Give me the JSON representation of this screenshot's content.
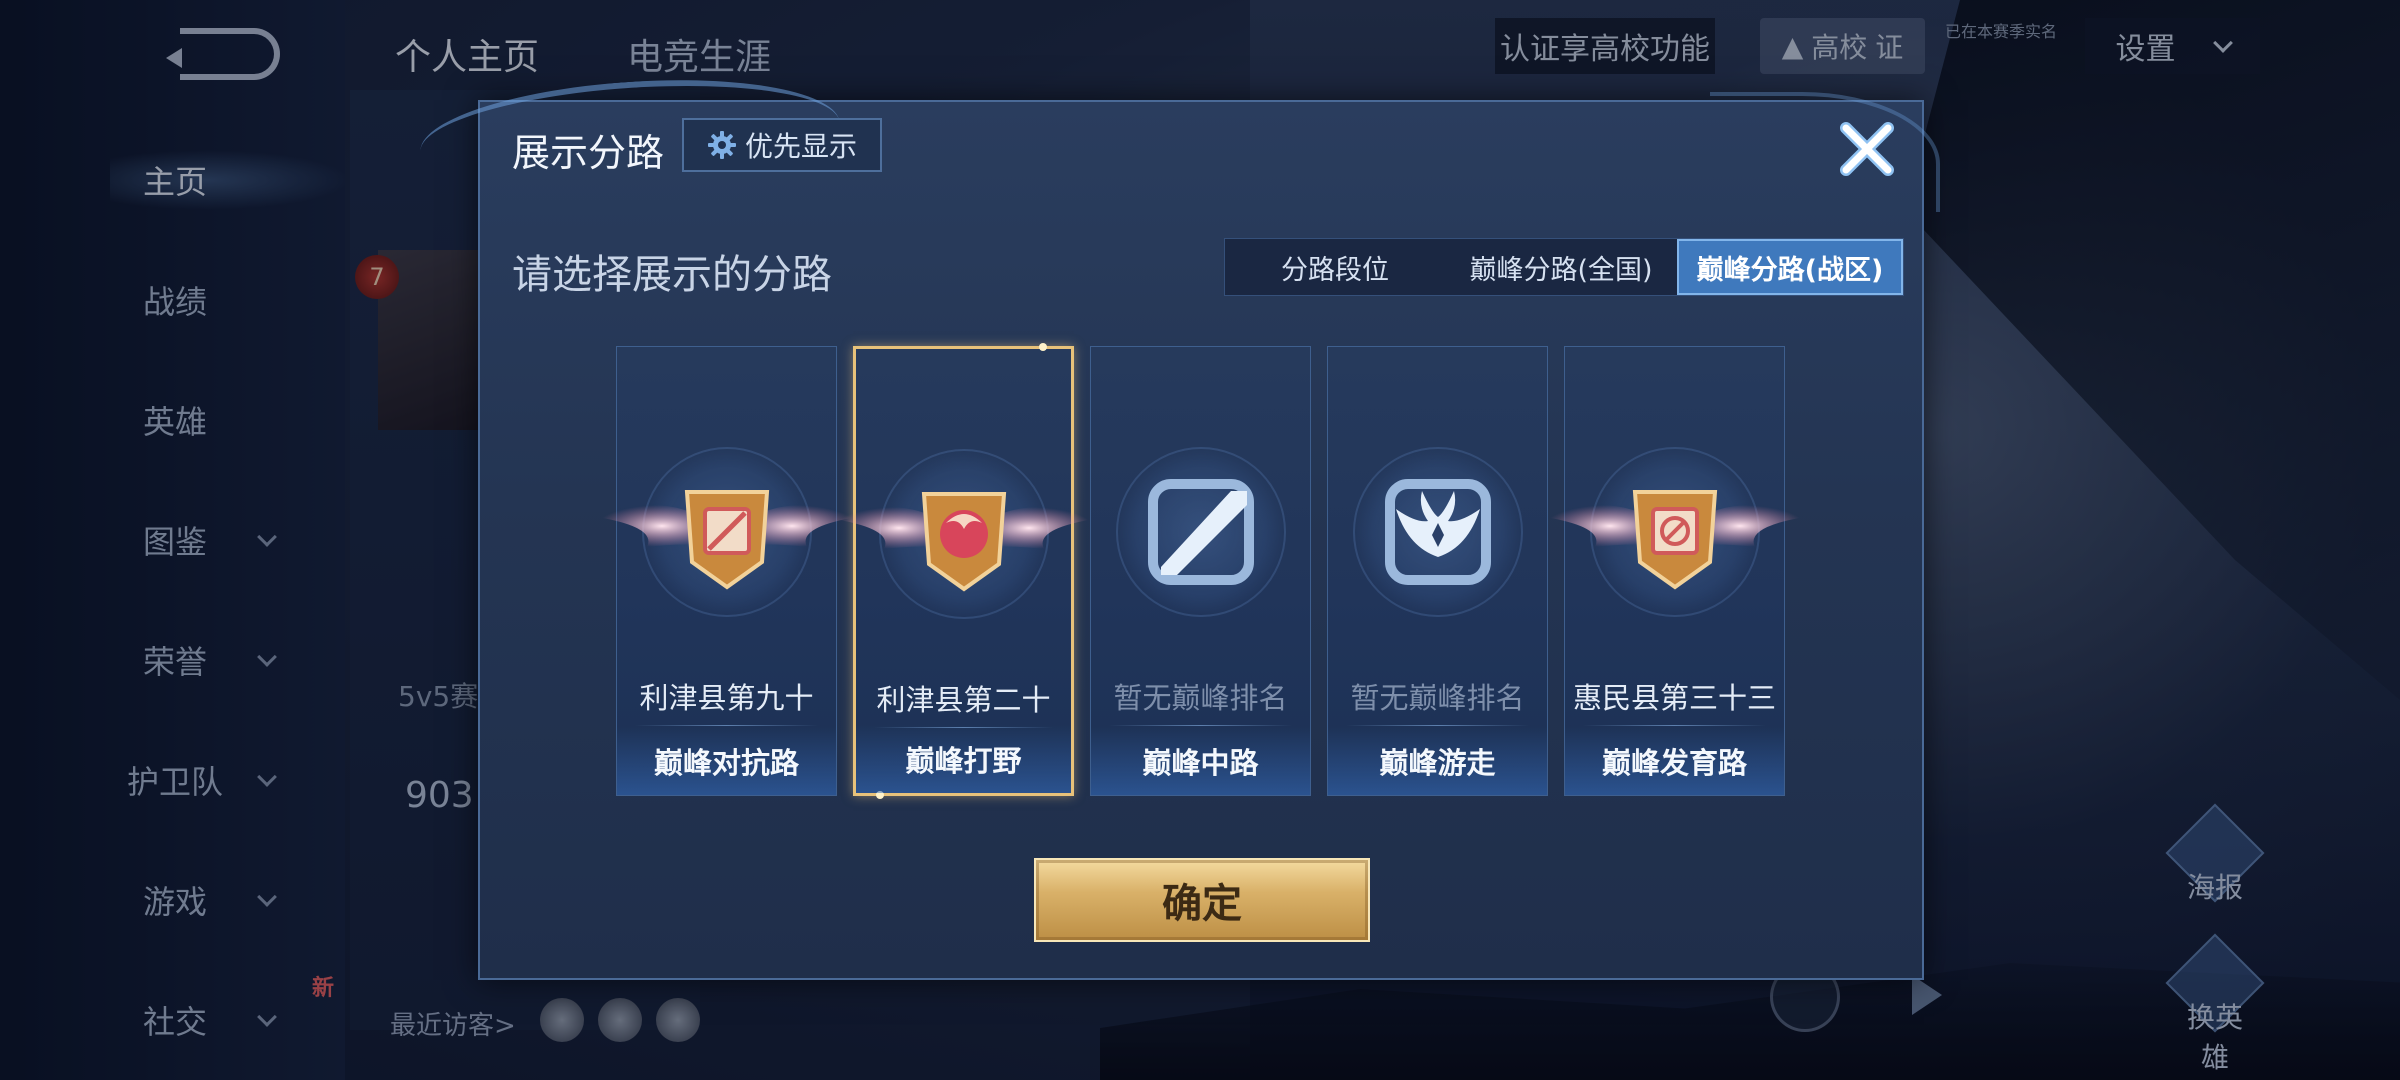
{
  "sidebar": {
    "items": [
      {
        "label": "主页",
        "active": true,
        "chevron": false
      },
      {
        "label": "战绩",
        "active": false,
        "chevron": false
      },
      {
        "label": "英雄",
        "active": false,
        "chevron": false
      },
      {
        "label": "图鉴",
        "active": false,
        "chevron": true
      },
      {
        "label": "荣誉",
        "active": false,
        "chevron": true
      },
      {
        "label": "护卫队",
        "active": false,
        "chevron": true
      },
      {
        "label": "游戏",
        "active": false,
        "chevron": true
      },
      {
        "label": "社交",
        "active": false,
        "chevron": true
      }
    ],
    "new_badge": "新"
  },
  "header": {
    "tabs": [
      "个人主页",
      "电竞生涯"
    ],
    "cert_label": "认证享高校功能",
    "gaoxiao_label": "高校",
    "gaoxiao_tail": "证",
    "settings_label": "设置",
    "small_note": "已在本赛季实名"
  },
  "profile": {
    "level": "7",
    "mode_text": "5v5赛",
    "big_num": "903",
    "recent_visit": "最近访客>"
  },
  "right_side": {
    "poster_label": "海报",
    "switch_hero_label": "换英雄"
  },
  "dialog": {
    "title": "展示分路",
    "priority_button": "优先显示",
    "subtitle": "请选择展示的分路",
    "tabs": [
      {
        "label": "分路段位",
        "active": false
      },
      {
        "label": "巅峰分路(全国)",
        "active": false
      },
      {
        "label": "巅峰分路(战区)",
        "active": true
      }
    ],
    "cards": [
      {
        "rank": "利津县第九十",
        "lane": "巅峰对抗路",
        "has_rank": true,
        "selected": false,
        "emblem": "clash-lane-emblem"
      },
      {
        "rank": "利津县第二十",
        "lane": "巅峰打野",
        "has_rank": true,
        "selected": true,
        "emblem": "jungle-emblem"
      },
      {
        "rank": "暂无巅峰排名",
        "lane": "巅峰中路",
        "has_rank": false,
        "selected": false,
        "emblem": "mid-lane-emblem"
      },
      {
        "rank": "暂无巅峰排名",
        "lane": "巅峰游走",
        "has_rank": false,
        "selected": false,
        "emblem": "roam-emblem"
      },
      {
        "rank": "惠民县第三十三",
        "lane": "巅峰发育路",
        "has_rank": true,
        "selected": false,
        "emblem": "farm-lane-emblem"
      }
    ],
    "confirm_button": "确定"
  },
  "colors": {
    "accent_blue": "#3f79bd",
    "gold": "#d9b169",
    "selected_border": "#e8c27a",
    "dialog_bg": "#243553"
  }
}
